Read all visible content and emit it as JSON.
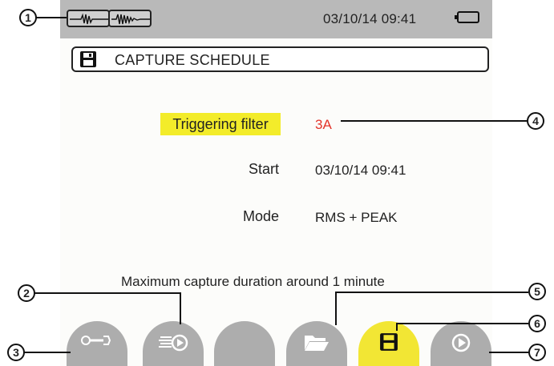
{
  "status_bar": {
    "mode_icons": [
      "waveform-icon",
      "transient-waveform-icon"
    ],
    "datetime": "03/10/14  09:41",
    "battery_icon": "battery-icon"
  },
  "title": {
    "icon": "floppy-disk-icon",
    "text": "CAPTURE SCHEDULE"
  },
  "settings": {
    "triggering_filter": {
      "label": "Triggering filter",
      "value": "3A"
    },
    "start": {
      "label": "Start",
      "value": "03/10/14  09:41"
    },
    "mode": {
      "label": "Mode",
      "value": "RMS + PEAK"
    }
  },
  "note": "Maximum capture duration around 1 minute",
  "soft_keys": [
    {
      "icon": "wrench-icon",
      "active": false
    },
    {
      "icon": "list-play-icon",
      "active": false
    },
    {
      "icon": "",
      "active": false
    },
    {
      "icon": "folder-open-icon",
      "active": false
    },
    {
      "icon": "floppy-disk-icon",
      "active": true
    },
    {
      "icon": "play-circle-icon",
      "active": false
    }
  ],
  "callouts": [
    "1",
    "2",
    "3",
    "4",
    "5",
    "6",
    "7"
  ],
  "colors": {
    "status_bar": "#b9b9b9",
    "highlight": "#f3ec2a",
    "value_accent": "#e3342a",
    "soft_key": "#adadad"
  }
}
